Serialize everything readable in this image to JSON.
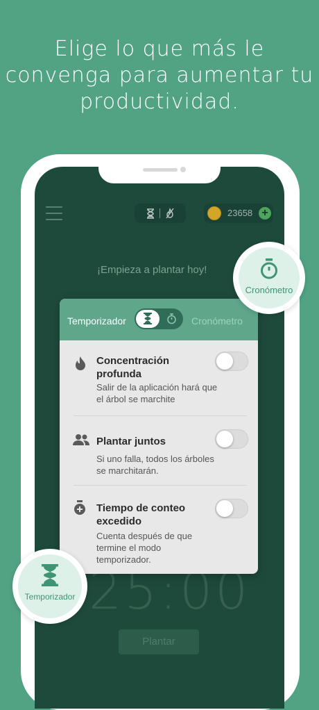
{
  "headline": {
    "line1": "Elige lo que más le",
    "line2": "convenga para aumentar tu",
    "line3": "productividad."
  },
  "topbar": {
    "coins": "23658",
    "plus": "+"
  },
  "prompt": "¡Empieza a plantar hoy!",
  "modes": {
    "timer_label": "Temporizador",
    "stopwatch_label": "Cronómetro"
  },
  "options": [
    {
      "title": "Concentración profunda",
      "description": "Salir de la aplicación hará que el árbol se marchite",
      "icon": "flame-icon",
      "enabled": false
    },
    {
      "title": "Plantar juntos",
      "description": "Si uno falla, todos los árboles se marchitarán.",
      "icon": "people-icon",
      "enabled": false
    },
    {
      "title": "Tiempo de conteo excedido",
      "description": "Cuenta después de que termine el modo temporizador.",
      "icon": "stopwatch-plus-icon",
      "enabled": false
    }
  ],
  "timer_display": "25:00",
  "plant_button": "Plantar",
  "badges": {
    "stopwatch": "Cronómetro",
    "timer": "Temporizador"
  },
  "colors": {
    "background": "#52a384",
    "screen": "#1e4a3c",
    "accent": "#5fa68b",
    "badge_text": "#3f9474"
  }
}
